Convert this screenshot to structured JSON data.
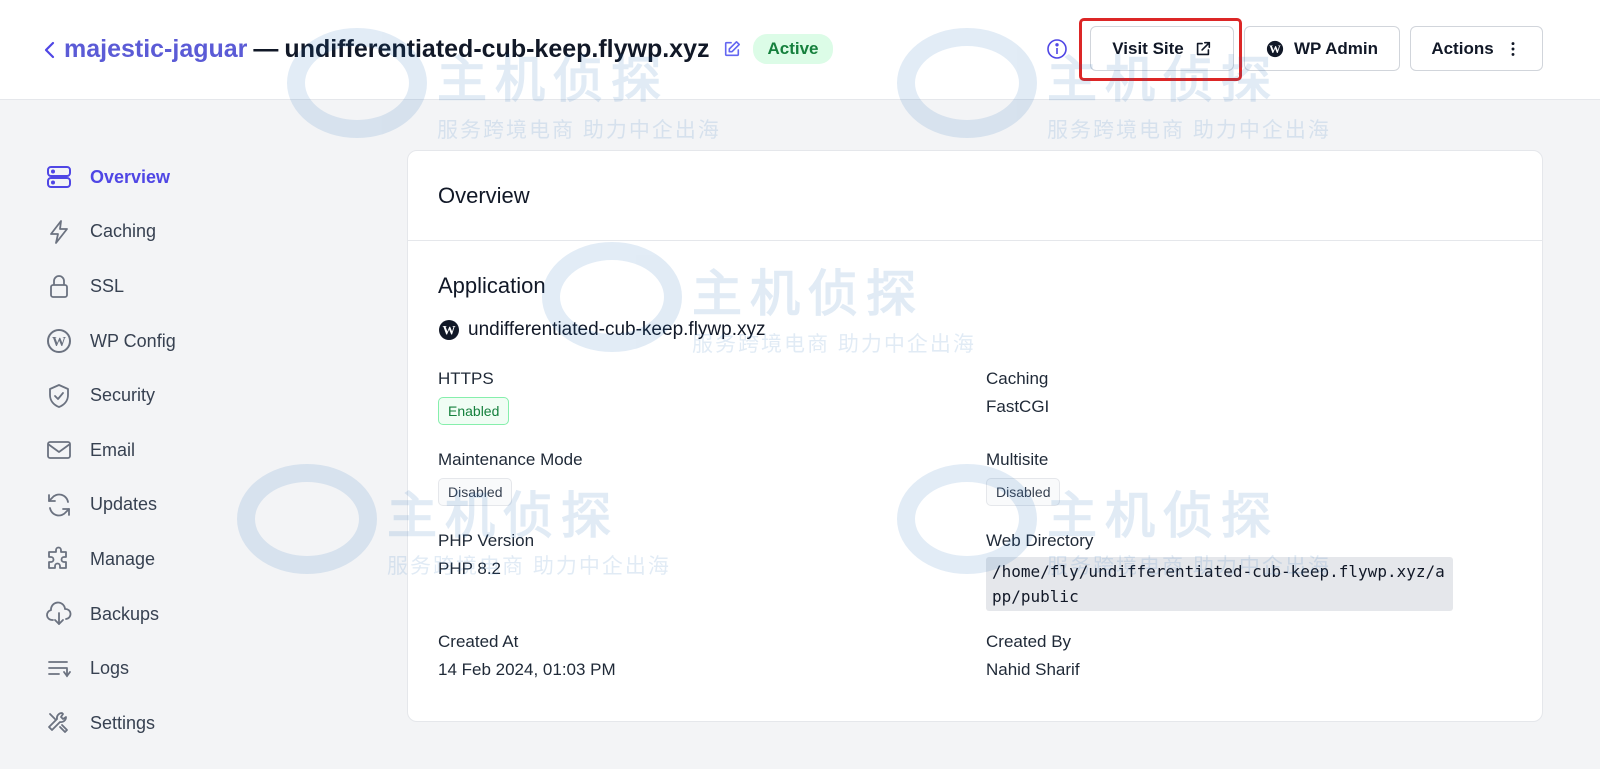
{
  "header": {
    "app_name": "majestic-jaguar",
    "separator": "—",
    "domain": "undifferentiated-cub-keep.flywp.xyz",
    "status_badge": "Active",
    "buttons": {
      "visit_site": "Visit Site",
      "wp_admin": "WP Admin",
      "actions": "Actions"
    }
  },
  "sidebar": {
    "items": [
      {
        "label": "Overview",
        "icon": "server-stack-icon",
        "active": true
      },
      {
        "label": "Caching",
        "icon": "bolt-icon"
      },
      {
        "label": "SSL",
        "icon": "lock-icon"
      },
      {
        "label": "WP Config",
        "icon": "wordpress-icon"
      },
      {
        "label": "Security",
        "icon": "shield-check-icon"
      },
      {
        "label": "Email",
        "icon": "envelope-icon"
      },
      {
        "label": "Updates",
        "icon": "refresh-icon"
      },
      {
        "label": "Manage",
        "icon": "puzzle-icon"
      },
      {
        "label": "Backups",
        "icon": "cloud-download-icon"
      },
      {
        "label": "Logs",
        "icon": "list-icon"
      },
      {
        "label": "Settings",
        "icon": "tools-icon"
      }
    ]
  },
  "overview": {
    "title": "Overview",
    "section_title": "Application",
    "app_domain": "undifferentiated-cub-keep.flywp.xyz",
    "fields": {
      "https": {
        "label": "HTTPS",
        "value": "Enabled"
      },
      "caching": {
        "label": "Caching",
        "value": "FastCGI"
      },
      "maintenance": {
        "label": "Maintenance Mode",
        "value": "Disabled"
      },
      "multisite": {
        "label": "Multisite",
        "value": "Disabled"
      },
      "php": {
        "label": "PHP Version",
        "value": "PHP 8.2"
      },
      "webdir": {
        "label": "Web Directory",
        "value": "/home/fly/undifferentiated-cub-keep.flywp.xyz/app/public"
      },
      "created_at": {
        "label": "Created At",
        "value": "14 Feb 2024, 01:03 PM"
      },
      "created_by": {
        "label": "Created By",
        "value": "Nahid Sharif"
      }
    }
  },
  "watermark": {
    "brand": "主机侦探",
    "slogan": "服务跨境电商  助力中企出海"
  },
  "colors": {
    "accent": "#4f46e5",
    "active_badge_bg": "#dcfce7",
    "active_badge_text": "#15803d",
    "highlight_border": "#dc2626"
  }
}
